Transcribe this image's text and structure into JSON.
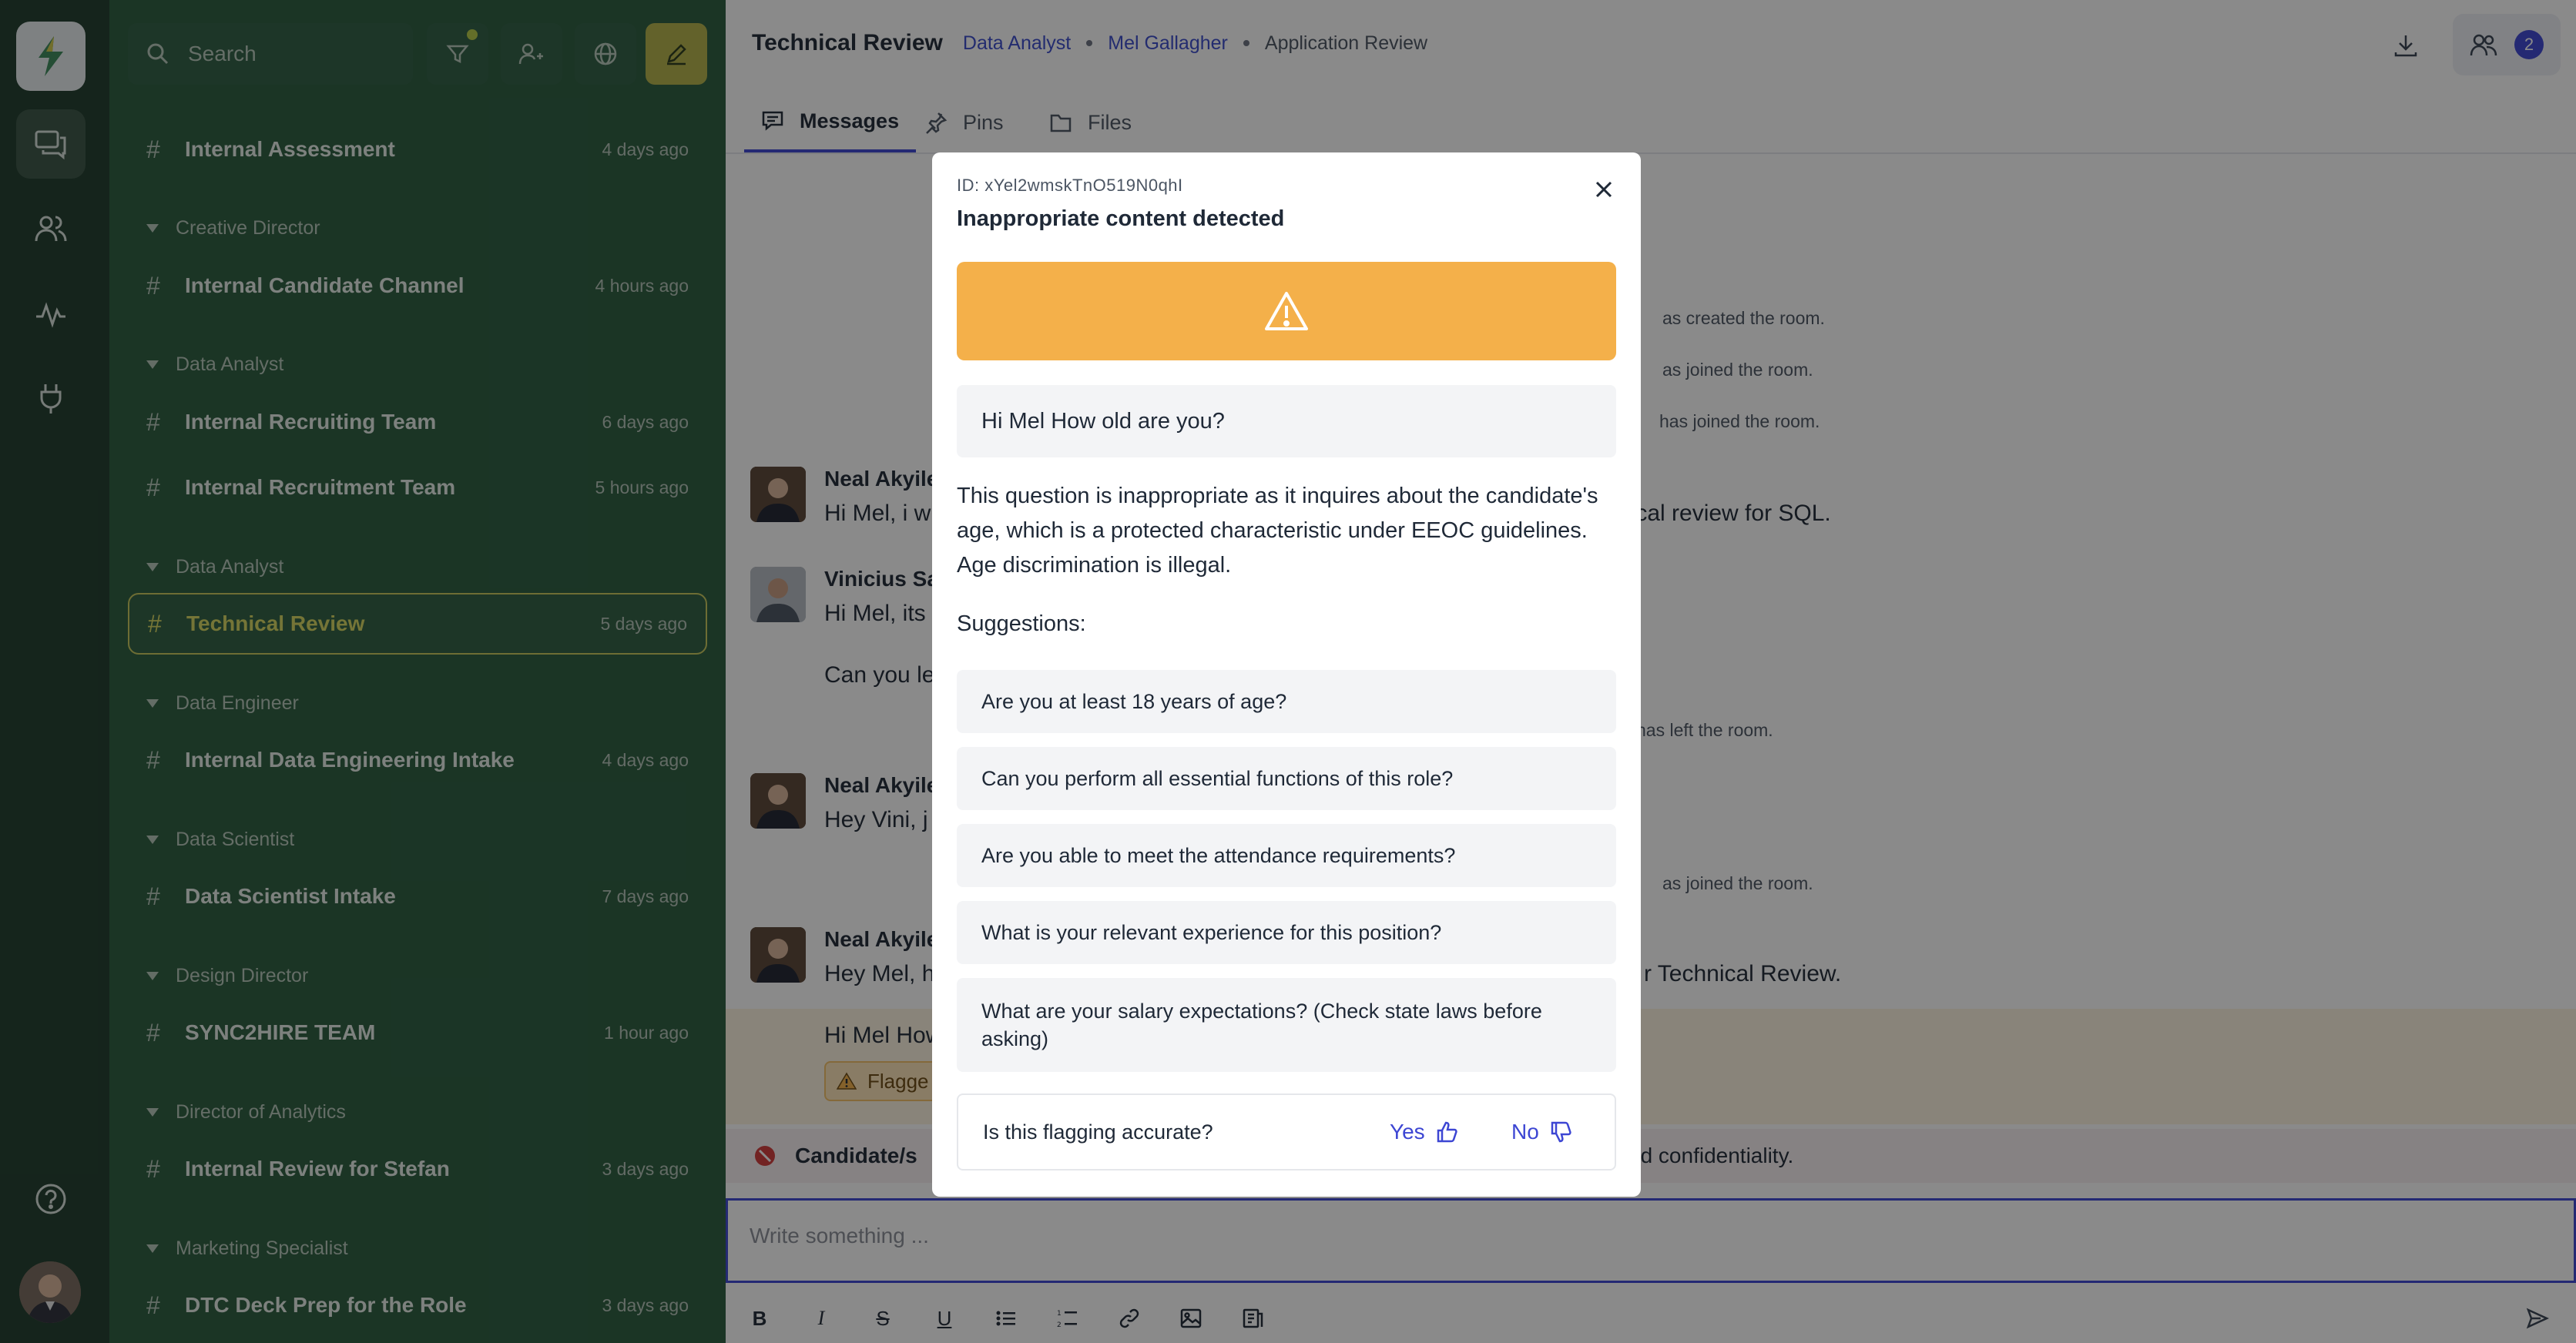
{
  "rail": {
    "items": [
      "logo-icon",
      "chat-icon",
      "people-icon",
      "activity-icon",
      "plug-icon"
    ],
    "bottom": [
      "help-icon",
      "avatar"
    ]
  },
  "sidebar": {
    "search_placeholder": "Search",
    "channels": [
      {
        "type": "channel",
        "name": "Internal Assessment",
        "time": "4 days ago"
      },
      {
        "type": "group",
        "name": "Creative Director"
      },
      {
        "type": "channel",
        "name": "Internal Candidate Channel",
        "time": "4 hours ago"
      },
      {
        "type": "group",
        "name": "Data Analyst"
      },
      {
        "type": "channel",
        "name": "Internal Recruiting Team",
        "time": "6 days ago"
      },
      {
        "type": "channel",
        "name": "Internal Recruitment Team",
        "time": "5 hours ago"
      },
      {
        "type": "group",
        "name": "Data Analyst"
      },
      {
        "type": "channel",
        "name": "Technical Review",
        "time": "5 days ago",
        "active": true
      },
      {
        "type": "group",
        "name": "Data Engineer"
      },
      {
        "type": "channel",
        "name": "Internal Data Engineering Intake",
        "time": "4 days ago"
      },
      {
        "type": "group",
        "name": "Data Scientist"
      },
      {
        "type": "channel",
        "name": "Data Scientist Intake",
        "time": "7 days ago"
      },
      {
        "type": "group",
        "name": "Design Director"
      },
      {
        "type": "channel",
        "name": "SYNC2HIRE TEAM",
        "time": "1 hour ago"
      },
      {
        "type": "group",
        "name": "Director of Analytics"
      },
      {
        "type": "channel",
        "name": "Internal Review for Stefan",
        "time": "3 days ago"
      },
      {
        "type": "group",
        "name": "Marketing Specialist"
      },
      {
        "type": "channel",
        "name": "DTC Deck Prep for the Role",
        "time": "3 days ago"
      }
    ]
  },
  "header": {
    "title": "Technical Review",
    "breadcrumb": [
      "Data Analyst",
      "Mel Gallagher",
      "Application Review"
    ],
    "members_count": "2"
  },
  "tabs": [
    "Messages",
    "Pins",
    "Files"
  ],
  "messages": {
    "sys1": "as created the room.",
    "sys2": "as joined the room.",
    "sys3": "has joined the room.",
    "m1_name": "Neal Akyile",
    "m1_text": "Hi Mel, i w",
    "m1_tail": "nical review for SQL.",
    "m2_name": "Vinicius Sa",
    "m2_text": "Hi Mel, its",
    "m2_text2": "Can you le",
    "sys4": "has left the room.",
    "m3_name": "Neal Akyile",
    "m3_text": "Hey Vini, j",
    "sys5": "as joined the room.",
    "m4_name": "Neal Akyile",
    "m4_text": "Hey Mel, h",
    "m4_tail": "r Technical Review.",
    "flag_text": "Hi Mel How",
    "flag_label": "Flagge",
    "cand_text": "Candidate/s",
    "cand_tail": "nd confidentiality."
  },
  "composer": {
    "placeholder": "Write something ..."
  },
  "modal": {
    "id_text": "ID: xYel2wmskTnO519N0qhI",
    "title": "Inappropriate content detected",
    "quoted": "Hi Mel How old are you?",
    "explanation": "This question is inappropriate as it inquires about the candidate's age, which is a protected characteristic under EEOC guidelines. Age discrimination is illegal.",
    "suggestions_heading": "Suggestions:",
    "suggestions": [
      "Are you at least 18 years of age?",
      "Can you perform all essential functions of this role?",
      "Are you able to meet the attendance requirements?",
      "What is your relevant experience for this position?",
      "What are your salary expectations? (Check state laws before asking)"
    ],
    "feedback_question": "Is this flagging accurate?",
    "yes_label": "Yes",
    "no_label": "No"
  },
  "colors": {
    "rail_bg": "#1f3d2c",
    "sidebar_bg": "#2b5c3f",
    "accent": "#3d46d3",
    "warning": "#f4b04a",
    "active_channel": "#d6d661"
  }
}
